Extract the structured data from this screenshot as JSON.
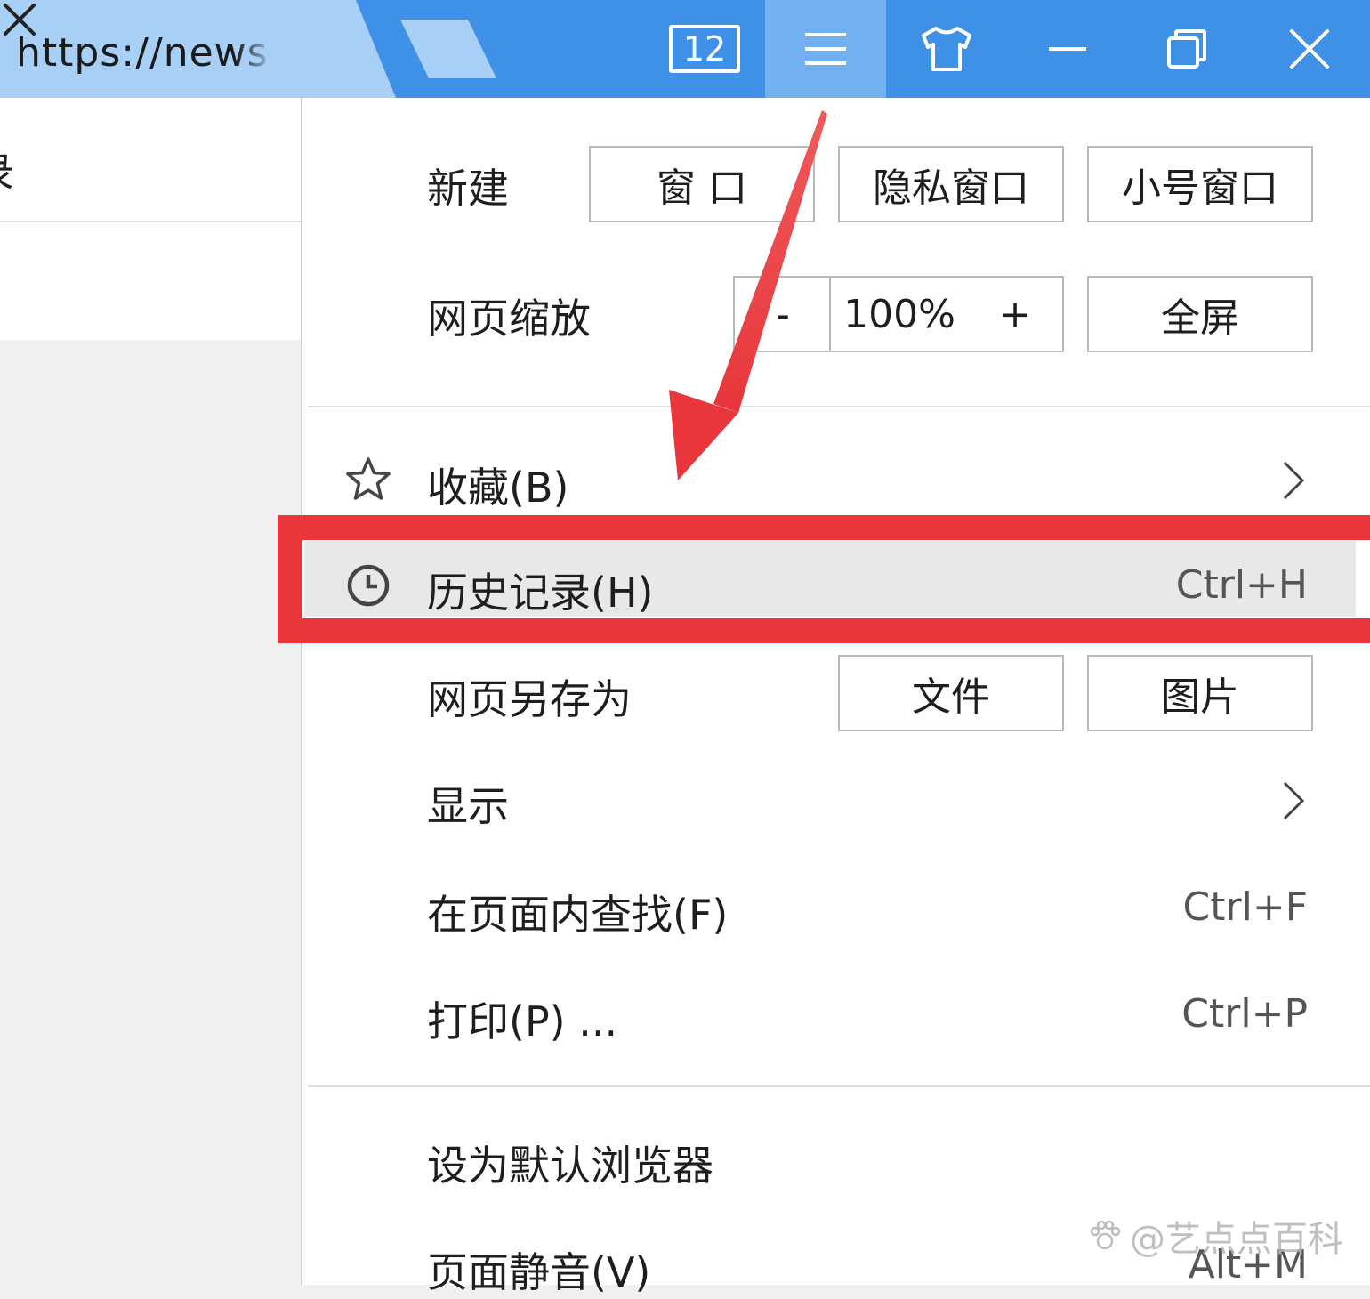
{
  "titlebar": {
    "tab_url": "https://news",
    "tab_count": "12",
    "controls": [
      "tab-count-icon",
      "menu-icon",
      "skin-shirt-icon",
      "minimize-icon",
      "restore-icon",
      "close-icon"
    ]
  },
  "page": {
    "partial_text": "录"
  },
  "menu": {
    "new_row": {
      "label": "新建",
      "buttons": [
        "窗 口",
        "隐私窗口",
        "小号窗口"
      ]
    },
    "zoom_row": {
      "label": "网页缩放",
      "minus": "-",
      "value": "100%",
      "plus": "+",
      "fullscreen": "全屏"
    },
    "favorites": {
      "label": "收藏(B)",
      "icon": "star-icon"
    },
    "history": {
      "label": "历史记录(H)",
      "shortcut": "Ctrl+H",
      "icon": "clock-icon"
    },
    "save_row": {
      "label": "网页另存为",
      "buttons": [
        "文件",
        "图片"
      ]
    },
    "display": {
      "label": "显示"
    },
    "find": {
      "label": "在页面内查找(F)",
      "shortcut": "Ctrl+F"
    },
    "print": {
      "label": "打印(P) ...",
      "shortcut": "Ctrl+P"
    },
    "default_browser": {
      "label": "设为默认浏览器"
    },
    "mute": {
      "label": "页面静音(V)",
      "shortcut": "Alt+M"
    }
  },
  "annotation": {
    "highlight_color": "#e8363c",
    "target": "history"
  },
  "watermark": "@艺点点百科",
  "colors": {
    "titlebar": "#3f91e8",
    "tab_active": "#a8d0f7",
    "menu_button_active": "#72b0f0"
  }
}
